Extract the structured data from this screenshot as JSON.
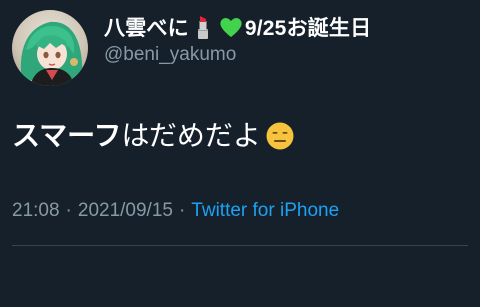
{
  "tweet": {
    "display_name_prefix": "八雲べに",
    "display_name_suffix": "9/25お誕生日",
    "name_icons": [
      "lipstick-icon",
      "green-heart-icon"
    ],
    "handle": "@beni_yakumo",
    "body_bold": "スマーフ",
    "body_rest": "はだめだよ",
    "body_emoji": "expressionless-face-icon",
    "time": "21:08",
    "separator": "·",
    "date": "2021/09/15",
    "source": "Twitter for iPhone"
  },
  "colors": {
    "background": "#15202b",
    "text": "#ffffff",
    "secondary": "#8899a6",
    "link": "#1da1f2",
    "divider": "#38444d"
  }
}
